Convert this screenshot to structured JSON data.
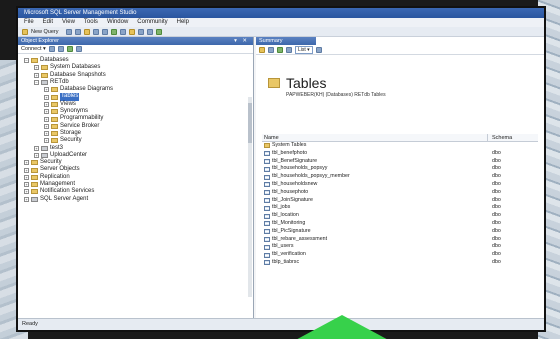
{
  "window": {
    "title": "Microsoft SQL Server Management Studio"
  },
  "menu": [
    "File",
    "Edit",
    "View",
    "Tools",
    "Window",
    "Community",
    "Help"
  ],
  "toolbar": {
    "new_query": "New Query"
  },
  "object_explorer": {
    "title": "Object Explorer",
    "controls": "▾ ✕",
    "connect": "Connect ▾",
    "tree": [
      {
        "indent": 1,
        "exp": "−",
        "icon": "folder",
        "label": "Databases"
      },
      {
        "indent": 2,
        "exp": "+",
        "icon": "folder",
        "label": "System Databases"
      },
      {
        "indent": 2,
        "exp": "+",
        "icon": "folder",
        "label": "Database Snapshots"
      },
      {
        "indent": 2,
        "exp": "−",
        "icon": "db",
        "label": "RETdb"
      },
      {
        "indent": 3,
        "exp": "+",
        "icon": "folder",
        "label": "Database Diagrams"
      },
      {
        "indent": 3,
        "exp": "+",
        "icon": "folder",
        "label": "Tables",
        "selected": true
      },
      {
        "indent": 3,
        "exp": "+",
        "icon": "folder",
        "label": "Views"
      },
      {
        "indent": 3,
        "exp": "+",
        "icon": "folder",
        "label": "Synonyms"
      },
      {
        "indent": 3,
        "exp": "+",
        "icon": "folder",
        "label": "Programmability"
      },
      {
        "indent": 3,
        "exp": "+",
        "icon": "folder",
        "label": "Service Broker"
      },
      {
        "indent": 3,
        "exp": "+",
        "icon": "folder",
        "label": "Storage"
      },
      {
        "indent": 3,
        "exp": "+",
        "icon": "folder",
        "label": "Security"
      },
      {
        "indent": 2,
        "exp": "+",
        "icon": "db",
        "label": "test3"
      },
      {
        "indent": 2,
        "exp": "+",
        "icon": "db",
        "label": "UploadCenter"
      },
      {
        "indent": 1,
        "exp": "+",
        "icon": "folder",
        "label": "Security"
      },
      {
        "indent": 1,
        "exp": "+",
        "icon": "folder",
        "label": "Server Objects"
      },
      {
        "indent": 1,
        "exp": "+",
        "icon": "folder",
        "label": "Replication"
      },
      {
        "indent": 1,
        "exp": "+",
        "icon": "folder",
        "label": "Management"
      },
      {
        "indent": 1,
        "exp": "+",
        "icon": "folder",
        "label": "Notification Services"
      },
      {
        "indent": 1,
        "exp": "+",
        "icon": "db",
        "label": "SQL Server Agent"
      }
    ]
  },
  "summary": {
    "tab": "Summary",
    "list_label": "List ▾",
    "title": "Tables",
    "path": "PAPWEBER(KH) (Databases) RETdb Tables",
    "columns": [
      "Name",
      "Schema"
    ],
    "rows": [
      {
        "name": "System Tables",
        "schema": "",
        "folder": true
      },
      {
        "name": "tbl_benefphoto",
        "schema": "dbo"
      },
      {
        "name": "tbl_BenefSignature",
        "schema": "dbo"
      },
      {
        "name": "tbl_households_popsyy",
        "schema": "dbo"
      },
      {
        "name": "tbl_households_popsyy_member",
        "schema": "dbo"
      },
      {
        "name": "tbl_householdsnew",
        "schema": "dbo"
      },
      {
        "name": "tbl_housephoto",
        "schema": "dbo"
      },
      {
        "name": "tbl_JoinSignature",
        "schema": "dbo"
      },
      {
        "name": "tbl_jobs",
        "schema": "dbo"
      },
      {
        "name": "tbl_location",
        "schema": "dbo"
      },
      {
        "name": "tbl_Monitoring",
        "schema": "dbo"
      },
      {
        "name": "tbl_PicSignature",
        "schema": "dbo"
      },
      {
        "name": "tbl_rebare_assessment",
        "schema": "dbo"
      },
      {
        "name": "tbl_users",
        "schema": "dbo"
      },
      {
        "name": "tbl_verification",
        "schema": "dbo"
      },
      {
        "name": "tblp_tiabrsc",
        "schema": "dbo"
      }
    ]
  },
  "status": {
    "text": "Ready"
  }
}
